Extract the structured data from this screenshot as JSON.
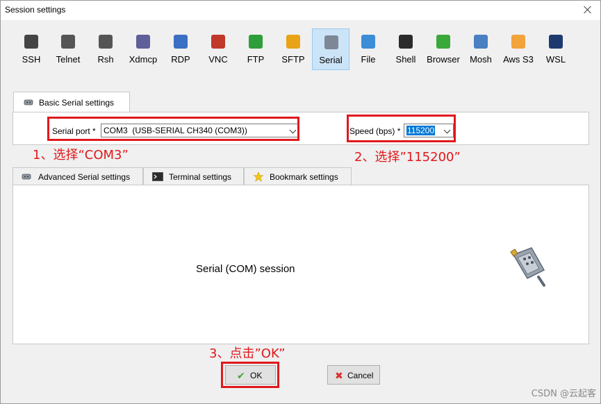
{
  "window": {
    "title": "Session settings"
  },
  "protocols": [
    {
      "label": "SSH",
      "icon": "ssh-icon",
      "color": "#444444"
    },
    {
      "label": "Telnet",
      "icon": "telnet-icon",
      "color": "#555555"
    },
    {
      "label": "Rsh",
      "icon": "rsh-icon",
      "color": "#555555"
    },
    {
      "label": "Xdmcp",
      "icon": "xdmcp-icon",
      "color": "#5f5f9a"
    },
    {
      "label": "RDP",
      "icon": "rdp-icon",
      "color": "#3a6fc4"
    },
    {
      "label": "VNC",
      "icon": "vnc-icon",
      "color": "#c0392b"
    },
    {
      "label": "FTP",
      "icon": "ftp-icon",
      "color": "#2e9e3a"
    },
    {
      "label": "SFTP",
      "icon": "sftp-icon",
      "color": "#e8a317"
    },
    {
      "label": "Serial",
      "icon": "serial-icon",
      "color": "#7d8896"
    },
    {
      "label": "File",
      "icon": "file-icon",
      "color": "#3c8dd8"
    },
    {
      "label": "Shell",
      "icon": "shell-icon",
      "color": "#2b2b2b"
    },
    {
      "label": "Browser",
      "icon": "browser-icon",
      "color": "#3aa83a"
    },
    {
      "label": "Mosh",
      "icon": "mosh-icon",
      "color": "#4a7fc1"
    },
    {
      "label": "Aws S3",
      "icon": "aws-s3-icon",
      "color": "#f2a33a"
    },
    {
      "label": "WSL",
      "icon": "wsl-icon",
      "color": "#1e3a6e"
    }
  ],
  "selected_protocol": "Serial",
  "basic_tab": {
    "label": "Basic Serial settings"
  },
  "serial_port": {
    "label": "Serial port *",
    "value": "COM3  (USB-SERIAL CH340 (COM3))"
  },
  "speed": {
    "label": "Speed (bps) *",
    "value": "115200"
  },
  "annotations": {
    "step1": "1、选择“COM3”",
    "step2": "2、选择”115200”",
    "step3": "3、点击”OK”"
  },
  "tabs": [
    {
      "label": "Advanced Serial settings"
    },
    {
      "label": "Terminal settings"
    },
    {
      "label": "Bookmark settings"
    }
  ],
  "session": {
    "text": "Serial (COM) session"
  },
  "buttons": {
    "ok": "OK",
    "cancel": "Cancel"
  },
  "watermark": "CSDN @云起客",
  "colors": {
    "annotation_red": "#e0181b",
    "selection_blue": "#0078d7",
    "selected_tile": "#cce4f7"
  }
}
